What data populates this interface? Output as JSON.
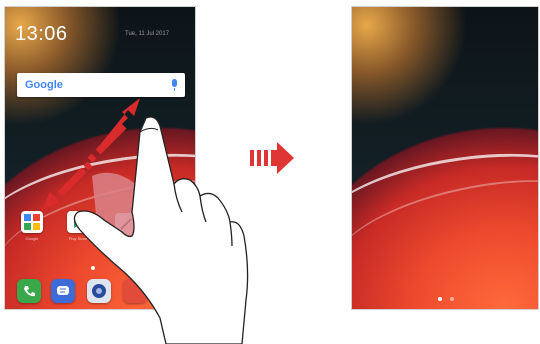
{
  "left_screen": {
    "time": "13:06",
    "date": "Tue, 11 Jul 2017",
    "search": {
      "logo": "Google",
      "mic_icon": "microphone-icon"
    },
    "apps": [
      {
        "icon": "google-folder-icon",
        "label": "Google"
      },
      {
        "icon": "play-store-icon",
        "label": "Play Store"
      },
      {
        "icon": "pen-icon",
        "label": ""
      }
    ],
    "dock": [
      {
        "icon": "phone-icon",
        "color": "#3aa84a"
      },
      {
        "icon": "messages-icon",
        "color": "#3d6bd8"
      },
      {
        "icon": "camera-icon",
        "color": "#2a4a9a"
      },
      {
        "icon": "app-icon",
        "color": "#e24a3a"
      }
    ]
  },
  "right_screen": {
    "page_indicator": {
      "count": 2,
      "active": 0
    }
  },
  "colors": {
    "accent_red": "#e03535",
    "pink_gesture": "#d9828a",
    "dock_phone": "#3aa84a"
  },
  "gesture": "pinch-in"
}
